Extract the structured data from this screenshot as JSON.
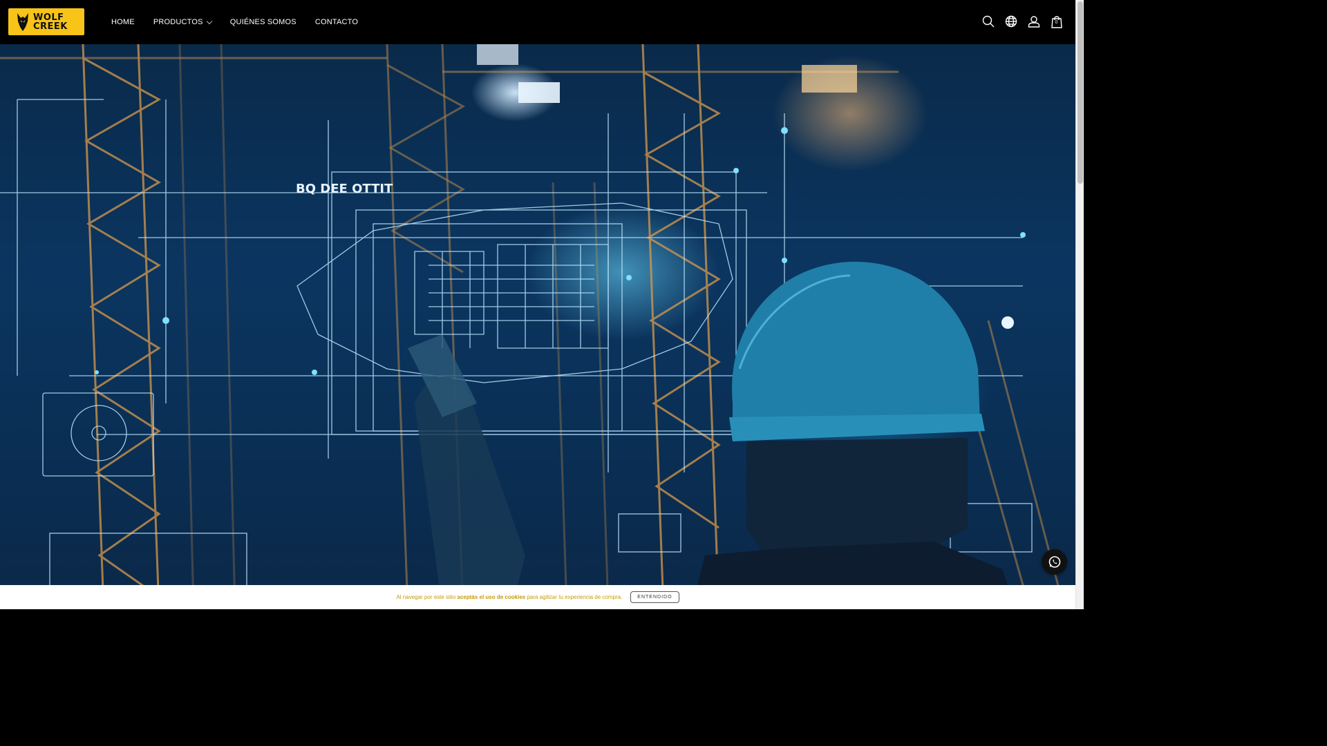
{
  "logo": {
    "line1": "WOLF",
    "line2": "CREEK",
    "icon": "wolf-head-icon",
    "bg": "#f7c417"
  },
  "nav": {
    "items": [
      {
        "label": "HOME"
      },
      {
        "label": "PRODUCTOS",
        "has_dropdown": true
      },
      {
        "label": "QUIÉNES SOMOS"
      },
      {
        "label": "CONTACTO"
      }
    ]
  },
  "header_icons": [
    "search-icon",
    "globe-icon",
    "user-icon",
    "shopping-bag-icon"
  ],
  "cart": {
    "count": "0"
  },
  "hero": {
    "overlay_text": "BQ DEE OTTIT"
  },
  "cookie": {
    "text_before": "Al navegar por este sitio ",
    "text_bold": "aceptás el uso de cookies",
    "text_after": " para agilizar tu experiencia de compra.",
    "button": "ENTENDIDO"
  },
  "colors": {
    "header_bg": "#000000",
    "accent": "#f7c417",
    "cookie_text": "#c79a00"
  }
}
